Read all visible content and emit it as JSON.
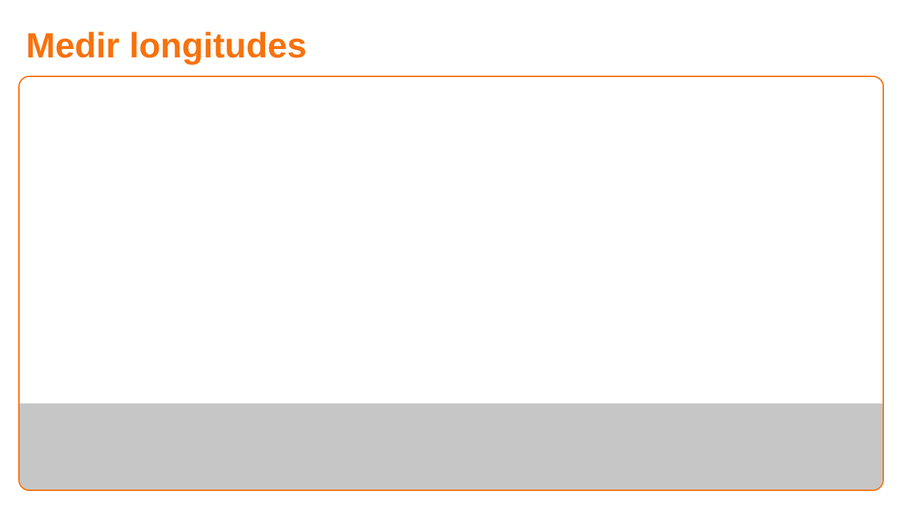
{
  "header": {
    "title": "Medir longitudes"
  },
  "colors": {
    "accent": "#f7720d",
    "panel_background": "#ffffff",
    "ground": "#c6c6c6"
  }
}
